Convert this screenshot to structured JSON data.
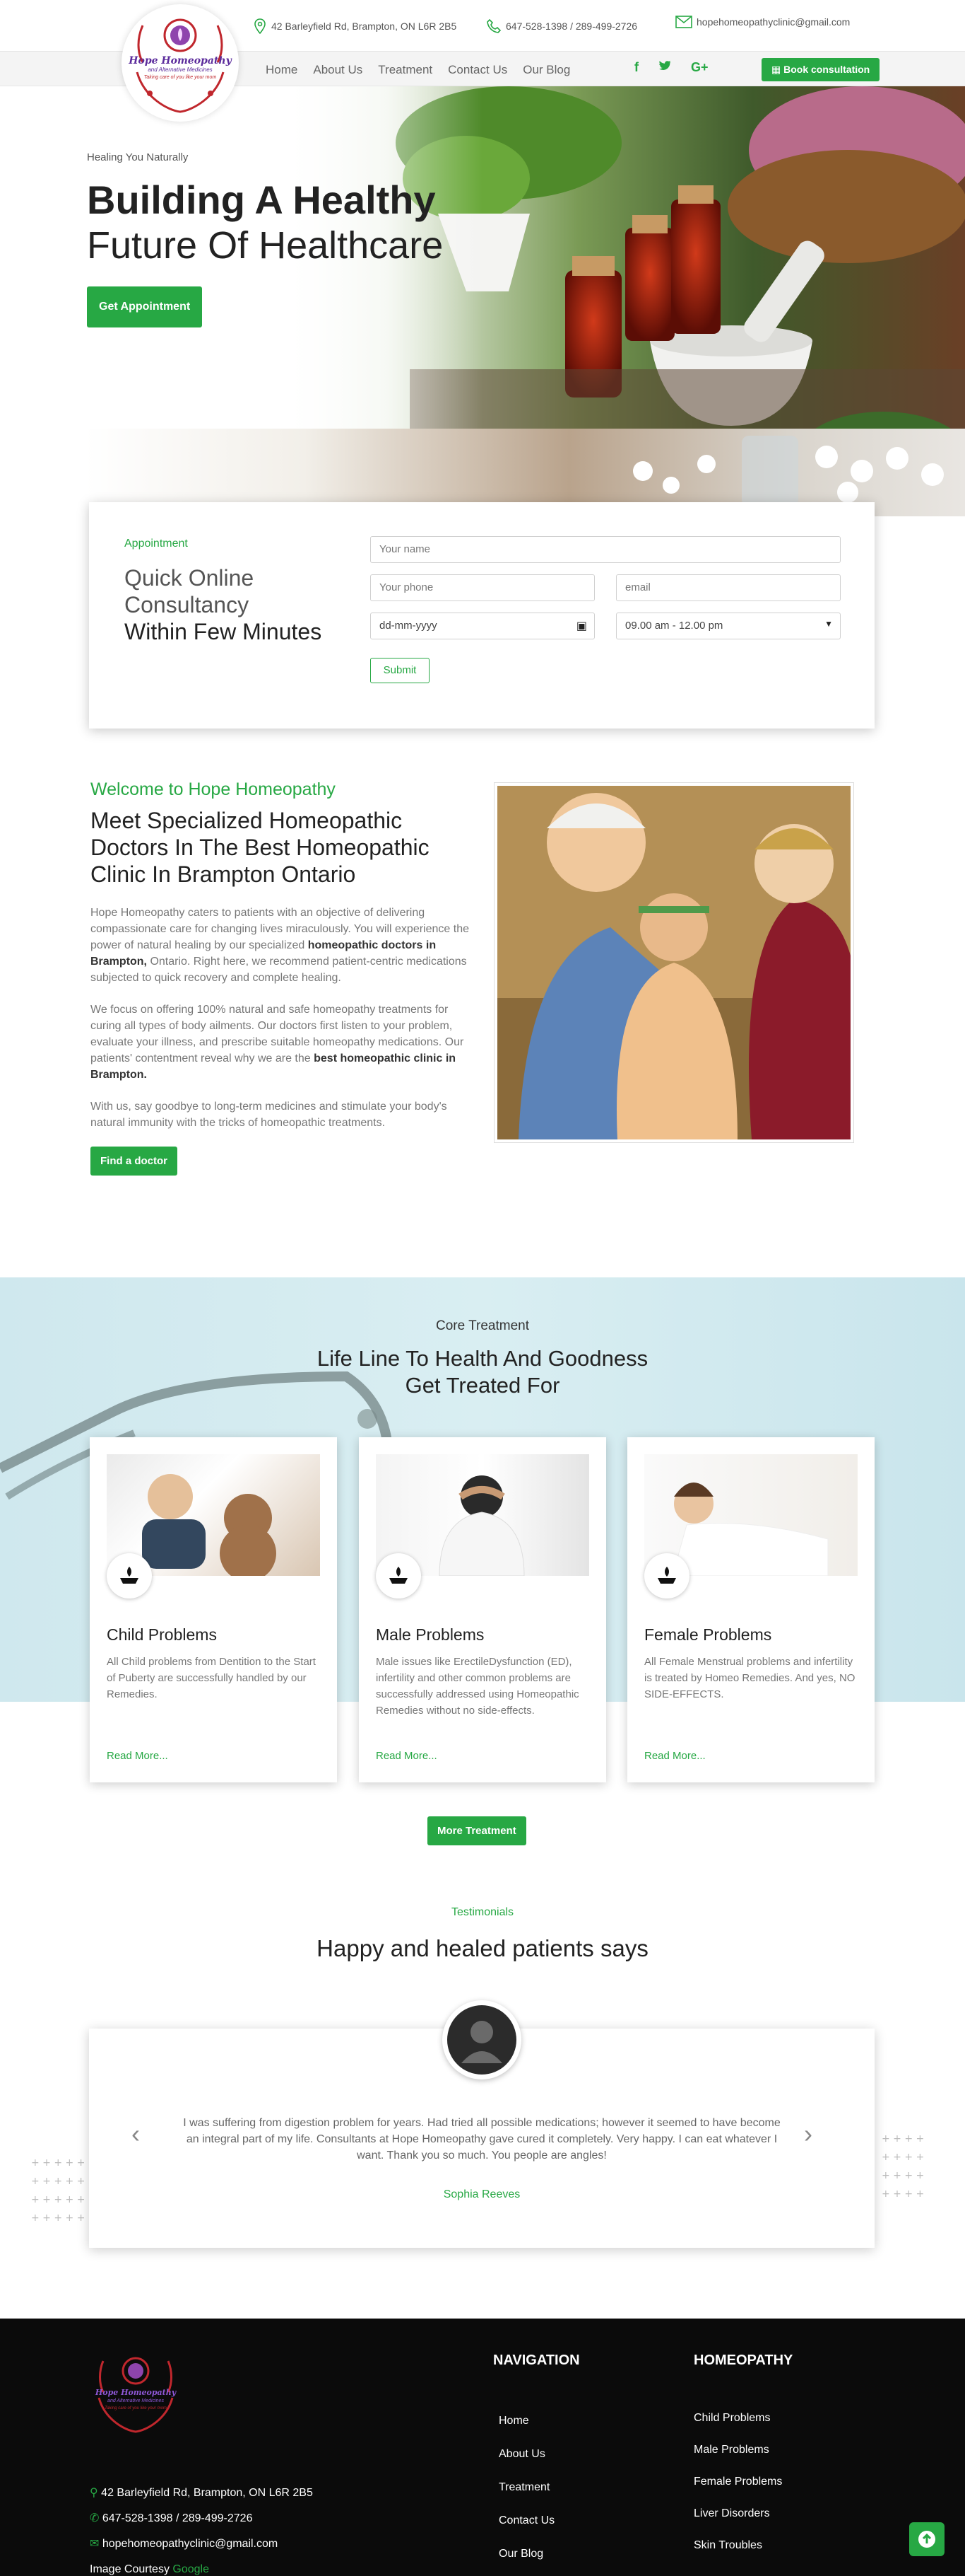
{
  "header": {
    "address": "42 Barleyfield Rd, Brampton, ON L6R 2B5",
    "phone": "647-528-1398 / 289-499-2726",
    "email": "hopehomeopathyclinic@gmail.com",
    "logo_text": "Hope Homeopathy",
    "logo_sub": "and Alternative Medicines",
    "logo_tag": "Taking care of you like your mom",
    "nav": [
      "Home",
      "About Us",
      "Treatment",
      "Contact Us",
      "Our Blog"
    ],
    "social": [
      "f",
      "t",
      "G+"
    ],
    "book_label": "Book consultation"
  },
  "hero": {
    "kicker": "Healing You Naturally",
    "title_bold": "Building A Healthy",
    "title_light": "Future Of Healthcare",
    "cta": "Get Appointment"
  },
  "appointment": {
    "kicker": "Appointment",
    "line1": "Quick Online",
    "line2": "Consultancy",
    "line3": "Within Few Minutes",
    "name_placeholder": "Your name",
    "phone_placeholder": "Your phone",
    "email_placeholder": "email",
    "date_placeholder": "dd-mm-yyyy",
    "time_value": "09.00 am - 12.00 pm",
    "submit": "Submit"
  },
  "welcome": {
    "kicker": "Welcome to Hope Homeopathy",
    "title": "Meet Specialized Homeopathic Doctors In The Best Homeopathic Clinic In Brampton Ontario",
    "p1_a": "Hope Homeopathy caters to patients with an objective of delivering compassionate care for changing lives miraculously. You will experience the power of natural healing by our specialized ",
    "p1_b": "homeopathic doctors in Brampton,",
    "p1_c": " Ontario. Right here, we recommend patient-centric medications subjected to quick recovery and complete healing.",
    "p2_a": "We focus on offering 100% natural and safe homeopathy treatments for curing all types of body ailments. Our doctors first listen to your problem, evaluate your illness, and prescribe suitable homeopathy medications. Our patients' contentment reveal why we are the ",
    "p2_b": "best homeopathic clinic in Brampton.",
    "p3": "With us, say goodbye to long-term medicines and stimulate your body's natural immunity with the tricks of homeopathic treatments.",
    "cta": "Find a doctor"
  },
  "core": {
    "kicker": "Core Treatment",
    "title1": "Life Line To Health And Goodness",
    "title2": "Get Treated For",
    "cards": [
      {
        "title": "Child Problems",
        "text": "All Child problems from Dentition to the Start of Puberty are successfully handled by our Remedies.",
        "more": "Read More..."
      },
      {
        "title": "Male Problems",
        "text": "Male issues like ErectileDysfunction (ED), infertility and other common problems are successfully addressed using Homeopathic Remedies without no side-effects.",
        "more": "Read More..."
      },
      {
        "title": "Female Problems",
        "text": "All Female Menstrual problems and infertility is treated by Homeo Remedies. And yes, NO SIDE-EFFECTS.",
        "more": "Read More..."
      }
    ],
    "more_button": "More Treatment"
  },
  "testimonials": {
    "kicker": "Testimonials",
    "title": "Happy and healed patients says",
    "quote": "I was suffering from digestion problem for years. Had tried all possible medications; however it seemed to have become an integral part of my life. Consultants at Hope Homeopathy gave cured it completely. Very happy. I can eat whatever I want. Thank you so much. You people are angles!",
    "author": "Sophia Reeves"
  },
  "footer": {
    "address": "42 Barleyfield Rd, Brampton, ON L6R 2B5",
    "phone": "647-528-1398 / 289-499-2726",
    "email": "hopehomeopathyclinic@gmail.com",
    "courtesy_a": "Image Courtesy ",
    "courtesy_b": "Google",
    "nav_title": "NAVIGATION",
    "nav": [
      "Home",
      "About Us",
      "Treatment",
      "Contact Us",
      "Our Blog"
    ],
    "homeo_title": "HOMEOPATHY",
    "homeo": [
      "Child Problems",
      "Male Problems",
      "Female Problems",
      "Liver Disorders",
      "Skin Troubles"
    ]
  },
  "colors": {
    "accent": "#27a844",
    "footer_bg": "#0b0b0b",
    "core_bg": "#d4ecf1"
  }
}
